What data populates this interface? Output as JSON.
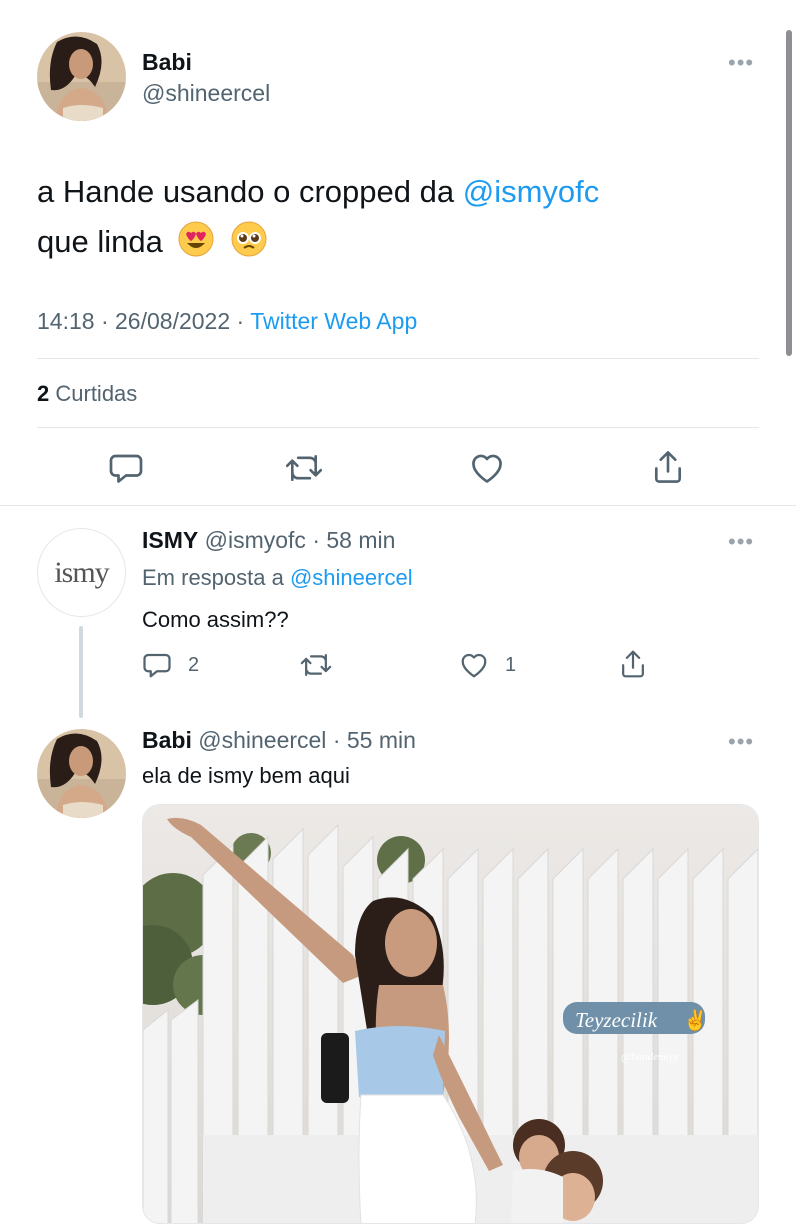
{
  "main_tweet": {
    "display_name": "Babi",
    "handle": "@shineercel",
    "text_pre": "a Hande usando o cropped da ",
    "mention": "@ismyofc",
    "text_line2": "que linda",
    "emojis": [
      "smiling-face-with-heart-eyes",
      "pleading-face"
    ],
    "time": "14:18",
    "date": "26/08/2022",
    "separator": "·",
    "source": "Twitter Web App",
    "likes_count": "2",
    "likes_label": "Curtidas"
  },
  "reply_1": {
    "display_name": "ISMY",
    "handle": "@ismyofc",
    "separator": "·",
    "time_ago": "58 min",
    "reply_to_label": "Em resposta a",
    "reply_to_handle": "@shineercel",
    "text": "Como assim??",
    "avatar_text": "ismy",
    "reply_count": "2",
    "like_count": "1"
  },
  "reply_2": {
    "display_name": "Babi",
    "handle": "@shineercel",
    "separator": "·",
    "time_ago": "55 min",
    "text": "ela de ismy bem aqui",
    "photo_caption": "Teyzecilik",
    "photo_caption_emoji": "victory-hand",
    "photo_tag": "@handemiyy"
  },
  "colors": {
    "link": "#1d9bf0",
    "secondary_text": "#536471",
    "primary_text": "#0f1419",
    "divider": "#e4e7ea"
  },
  "icons": [
    "more-icon",
    "reply-icon",
    "retweet-icon",
    "like-icon",
    "share-icon"
  ]
}
